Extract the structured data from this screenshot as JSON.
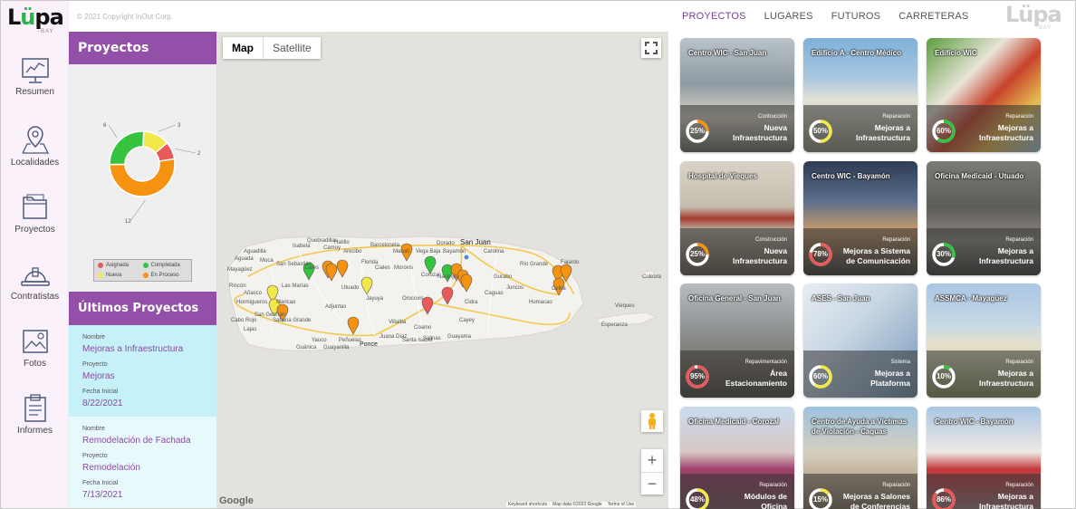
{
  "app": {
    "logo_text": "Lupa",
    "logo_sub": "BAY",
    "copyright": "© 2021 Copyright InOut Corp."
  },
  "sidebar": {
    "items": [
      {
        "label": "Resumen",
        "icon": "dashboard-icon"
      },
      {
        "label": "Localidades",
        "icon": "map-pin-icon"
      },
      {
        "label": "Proyectos",
        "icon": "folder-icon"
      },
      {
        "label": "Contratistas",
        "icon": "hard-hat-icon"
      },
      {
        "label": "Fotos",
        "icon": "photo-icon"
      },
      {
        "label": "Informes",
        "icon": "clipboard-icon"
      }
    ]
  },
  "topnav": {
    "items": [
      {
        "label": "PROYECTOS",
        "active": true
      },
      {
        "label": "LUGARES",
        "active": false
      },
      {
        "label": "FUTUROS",
        "active": false
      },
      {
        "label": "CARRETERAS",
        "active": false
      }
    ]
  },
  "projects_panel": {
    "title": "Proyectos",
    "legend": [
      {
        "label": "Asignada",
        "color": "#e85a5a"
      },
      {
        "label": "Completada",
        "color": "#35c23f"
      },
      {
        "label": "Nueva",
        "color": "#f2e84b"
      },
      {
        "label": "En Proceso",
        "color": "#f5920f"
      }
    ]
  },
  "chart_data": {
    "type": "pie",
    "donut": true,
    "categories": [
      "Asignada",
      "Completada",
      "Nueva",
      "En Proceso"
    ],
    "values": [
      2,
      6,
      3,
      12
    ],
    "colors": [
      "#e85a5a",
      "#35c23f",
      "#f2e84b",
      "#f5920f"
    ],
    "data_labels": [
      "2",
      "6",
      "3",
      "12"
    ],
    "legend_position": "bottom"
  },
  "latest_projects": {
    "title": "Últimos Proyectos",
    "items": [
      {
        "name_label": "Nombre",
        "name": "Mejoras a Infraestructura",
        "project_label": "Proyecto",
        "project": "Mejoras",
        "date_label": "Fecha Inicial",
        "date": "8/22/2021"
      },
      {
        "name_label": "Nombre",
        "name": "Remodelación de Fachada",
        "project_label": "Proyecto",
        "project": "Remodelación",
        "date_label": "Fecha Inicial",
        "date": "7/13/2021"
      }
    ]
  },
  "map": {
    "type_buttons": [
      "Map",
      "Satellite"
    ],
    "active_type": "Map",
    "place_labels": [
      "San Juan",
      "Ponce",
      "Caguas",
      "Cayey",
      "Coamo",
      "Utuado",
      "Barceloneta",
      "Dorado",
      "Vieques",
      "Culebra",
      "Esperanza",
      "Aguadilla",
      "Isabela",
      "Hatillo",
      "Mayagüez",
      "Yauco",
      "Guayama",
      "Humacao",
      "Fajardo",
      "Ceiba",
      "Río Grande",
      "Bayamón",
      "Carolina",
      "Arecibo",
      "Manatí",
      "Vega Baja",
      "Morovis",
      "Corozal",
      "Naranjito",
      "Cidra",
      "Juncos",
      "Gurabo",
      "Salinas",
      "Santa Isabel",
      "Juana Díaz",
      "Villalba",
      "Orocovis",
      "Jayuya",
      "Adjuntas",
      "Lares",
      "San Sebastián",
      "Moca",
      "Rincón",
      "Añasco",
      "Las Marías",
      "Maricao",
      "Sabana Grande",
      "San Germán",
      "Lajas",
      "Cabo Rojo",
      "Hormigueros",
      "Guánica",
      "Guayanilla",
      "Peñuelas",
      "Ciales",
      "Florida",
      "Quebradillas",
      "Camuy",
      "Aguada"
    ],
    "google_label": "Google",
    "attribution": [
      "Keyboard shortcuts",
      "Map data ©2022 Google",
      "Terms of Use"
    ],
    "zoom_in": "+",
    "zoom_out": "−"
  },
  "project_cards": [
    {
      "title": "Centro WIC - San Juan",
      "category": "Contrucción",
      "type": "Nueva Infraestructura",
      "percent": "25%",
      "progress": 25,
      "ring_color": "#f5920f",
      "photo": "lobby"
    },
    {
      "title": "Edificio A - Centro Médico",
      "category": "Reparación",
      "type": "Mejoras a Infraestructura",
      "percent": "50%",
      "progress": 50,
      "ring_color": "#f2e84b",
      "photo": "building"
    },
    {
      "title": "Edificio WIC",
      "category": "Reparación",
      "type": "Mejoras a Infraestructura",
      "percent": "60%",
      "progress": 60,
      "ring_color": "#35c23f",
      "photo": "mural"
    },
    {
      "title": "Hospital de Vieques",
      "category": "Construcción",
      "type": "Nueva Infraestructura",
      "percent": "25%",
      "progress": 25,
      "ring_color": "#f5920f",
      "photo": "hospital"
    },
    {
      "title": "Centro WIC - Bayamón",
      "category": "Reparación",
      "type": "Mejoras a Sistema de Comunicación",
      "percent": "78%",
      "progress": 78,
      "ring_color": "#e85a5a",
      "photo": "waiting"
    },
    {
      "title": "Oficina Medicaid - Utuado",
      "category": "Reparación",
      "type": "Mejoras a Infraestructura",
      "percent": "30%",
      "progress": 30,
      "ring_color": "#35c23f",
      "photo": "damage"
    },
    {
      "title": "Oficina General - San Juan",
      "category": "Repavimentación",
      "type": "Área Estacionamiento",
      "percent": "95%",
      "progress": 95,
      "ring_color": "#e85a5a",
      "photo": "pothole"
    },
    {
      "title": "ASES - San Juan",
      "category": "Sistema",
      "type": "Mejoras a Plataforma",
      "percent": "60%",
      "progress": 60,
      "ring_color": "#f2e84b",
      "photo": "medical"
    },
    {
      "title": "ASSMCA - Mayagüez",
      "category": "Reparación",
      "type": "Mejoras a Infraestructura",
      "percent": "10%",
      "progress": 10,
      "ring_color": "#35c23f",
      "photo": "sign"
    },
    {
      "title": "Oficina Medicaid - Corozal",
      "category": "Reparación",
      "type": "Módulos de Oficina",
      "percent": "48%",
      "progress": 48,
      "ring_color": "#f2e84b",
      "photo": "street"
    },
    {
      "title": "Centro de Ayuda a Víctimas de Violación - Caguas",
      "category": "Reparación",
      "type": "Mejoras a Salones de Conferencias",
      "percent": "15%",
      "progress": 15,
      "ring_color": "#f2e84b",
      "photo": "building2"
    },
    {
      "title": "Centro WIC - Bayamón",
      "category": "Reparación",
      "type": "Mejoras a Infraestructura",
      "percent": "86%",
      "progress": 86,
      "ring_color": "#e85a5a",
      "photo": "wic"
    }
  ]
}
